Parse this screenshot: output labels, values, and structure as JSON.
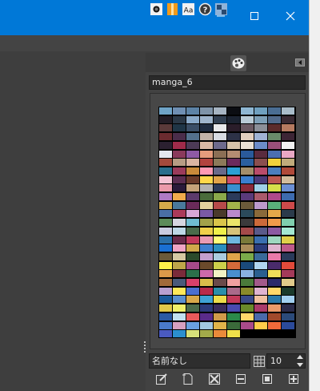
{
  "window": {
    "minimize_icon": "minimize-icon",
    "maximize_icon": "maximize-icon",
    "close_icon": "close-icon"
  },
  "panel": {
    "tabs": [
      {
        "icon": "brush-dynamics-icon"
      },
      {
        "icon": "pattern-icon"
      },
      {
        "icon": "fonts-icon",
        "label": "Aa"
      },
      {
        "icon": "help-icon",
        "label": "?"
      },
      {
        "icon": "image-icon"
      },
      {
        "icon": "palette-icon",
        "active": true
      }
    ],
    "palette_name": "manga_6",
    "entry_name": "名前なし",
    "columns": "10",
    "toolbar": [
      {
        "icon": "edit-icon"
      },
      {
        "icon": "new-entry-icon"
      },
      {
        "icon": "delete-icon"
      },
      {
        "icon": "fg-color-icon"
      },
      {
        "icon": "bg-color-icon"
      },
      {
        "icon": "add-icon"
      }
    ]
  },
  "palette": {
    "colors": [
      "#6fa3c7",
      "#6f8fb3",
      "#5d83a6",
      "#7f93a8",
      "#a6b4c2",
      "#0b0d12",
      "#8fb7d3",
      "#6fa0bf",
      "#4a6d93",
      "#a9bcc9",
      "#231d26",
      "#2b3846",
      "#8aa9c8",
      "#9fb4cb",
      "#324052",
      "#1b2331",
      "#b9cbd6",
      "#7d9fb7",
      "#526a8b",
      "#3a2a33",
      "#5a3a3a",
      "#1f3546",
      "#3b4e66",
      "#1f2b3f",
      "#e8e8ea",
      "#2a1d2a",
      "#6b5a63",
      "#8b8f98",
      "#5c2b2b",
      "#b57a60",
      "#6b2b2f",
      "#4a2d4a",
      "#54718d",
      "#c1b2a8",
      "#d8dbe2",
      "#2d3247",
      "#e2cfbe",
      "#a0b3d4",
      "#6a8a6a",
      "#3d2535",
      "#2b2030",
      "#a02b4a",
      "#4c3a56",
      "#d8b8a6",
      "#6d6a8c",
      "#d6c3aa",
      "#e9e0d4",
      "#6c8cc9",
      "#9a4f7a",
      "#f2f2f2",
      "#e4e6ee",
      "#8a3a5b",
      "#8e5aa4",
      "#e59c7c",
      "#8b6f55",
      "#b58c72",
      "#2a5a9b",
      "#5a2b3e",
      "#4b6fb0",
      "#e9a8c4",
      "#a44a3c",
      "#b79c84",
      "#d9b4a2",
      "#b2433f",
      "#8c7a5a",
      "#6b2b5c",
      "#2b5f9f",
      "#8a4f4f",
      "#f0d23c",
      "#c1ab7b",
      "#2b6f8c",
      "#9b3b5b",
      "#c98a3a",
      "#ff9ab3",
      "#6a6a8a",
      "#2b9fd4",
      "#a38e6b",
      "#ba4c6a",
      "#4a7fbf",
      "#b04a3a",
      "#f3c4d4",
      "#5c2d51",
      "#6b3b2b",
      "#ffd84a",
      "#e2a44a",
      "#cb4e6a",
      "#3b7fcf",
      "#4a3a7a",
      "#bc5a52",
      "#d2bc9c",
      "#ea9aaa",
      "#2a1a3a",
      "#c5a37a",
      "#b2b2b2",
      "#2b3b5a",
      "#3a8fcf",
      "#8a2a3a",
      "#9fd1e9",
      "#d6e04a",
      "#6b8fd4",
      "#b07ac4",
      "#f1ac4c",
      "#5c3a6b",
      "#4a6b3b",
      "#8aa94a",
      "#2b3b5b",
      "#5a3a7a",
      "#aa5a6b",
      "#b04a8a",
      "#3d6bb0",
      "#d4aa4a",
      "#4a7a9b",
      "#6a2b5a",
      "#e3cf9c",
      "#b64a4a",
      "#a2b24a",
      "#6b5a3a",
      "#bb9acc",
      "#5aaf7a",
      "#ce4a4a",
      "#4a6fa5",
      "#ab3a5a",
      "#d7a8d6",
      "#7b5aa4",
      "#4a3a2b",
      "#ba8acc",
      "#2b4a5b",
      "#8a6a3a",
      "#e3a84a",
      "#2b3b4b",
      "#5c8c5a",
      "#d6d6e0",
      "#6fbcd0",
      "#a2a24a",
      "#d9c54a",
      "#ebe46a",
      "#3b3a3b",
      "#cc6a3a",
      "#ef9b4a",
      "#7fcfae",
      "#c9cce0",
      "#bdd8e6",
      "#4a6b4a",
      "#efd04a",
      "#f0f04a",
      "#d7c27a",
      "#a44a4a",
      "#5a5a8a",
      "#8c5aa2",
      "#a4e8d2",
      "#2b6fa7",
      "#6a2a4a",
      "#c03a5a",
      "#ea9bb4",
      "#fffc7a",
      "#6fb7e0",
      "#7a7a3a",
      "#3a6fb0",
      "#9ed8c0",
      "#e0d04a",
      "#1a6fd2",
      "#f0a4c4",
      "#d0a84a",
      "#3f7fcf",
      "#2b8fbf",
      "#5a2b4a",
      "#aa8c5a",
      "#2b3b7b",
      "#e0b4cf",
      "#bf5a8a",
      "#6a5a3a",
      "#d6c8a2",
      "#2b4a2b",
      "#c29fcf",
      "#aacce0",
      "#e0a44a",
      "#7aaa4a",
      "#3a6a9a",
      "#ea7aaa",
      "#2a3a5a",
      "#fff24a",
      "#bea64a",
      "#a64a8a",
      "#6a4a2b",
      "#ccd04a",
      "#d46a3a",
      "#1a4a7b",
      "#b1d6f0",
      "#4a2b6b",
      "#e24a3a",
      "#dc9a4a",
      "#7a2b3a",
      "#2b6f4a",
      "#cc6aaa",
      "#f2f2c4",
      "#4a8fcf",
      "#8ab2e0",
      "#2a5f8f",
      "#eedc5a",
      "#a43a5a",
      "#a06a3a",
      "#4a5a7a",
      "#d6406a",
      "#d9bc4a",
      "#6a4a4a",
      "#f0a0a0",
      "#4a7a3a",
      "#a25a8a",
      "#2b2b6b",
      "#e0ca8a",
      "#b8a0d0",
      "#ffe85a",
      "#4a6fcf",
      "#b82b4a",
      "#2b8faa",
      "#aa6a8a",
      "#8a8a2b",
      "#e0b4d0",
      "#ffd86a",
      "#1a3a2b",
      "#1a5a9a",
      "#5a8fcf",
      "#d8a84a",
      "#3fa2d4",
      "#eedd4a",
      "#c43a5a",
      "#3a4a8a",
      "#f0c0a0",
      "#2a7aaa",
      "#a2d0f0",
      "#e0c84a",
      "#f0f06a",
      "#4a6a4a",
      "#2b3a7a",
      "#3a2b5a",
      "#4a4ab0",
      "#6a8a2b",
      "#aa3a6a",
      "#ea9a6a",
      "#2b2b4a",
      "#2b5aa4",
      "#c2e0f0",
      "#ea5a5a",
      "#5a2b8a",
      "#d09a4a",
      "#2b8a4a",
      "#ffd86a",
      "#4a6aaa",
      "#a24a2b",
      "#2b4a7a",
      "#4a7aca",
      "#d6a0c0",
      "#6aa0e0",
      "#a2c8e0",
      "#e0b44a",
      "#3a6a3a",
      "#aa4a8a",
      "#ffcc4a",
      "#f06a3a",
      "#2b4a9a",
      "#4a5abf",
      "#2b8fcf",
      "#d6e07a",
      "#a2aa4a",
      "#ea8a3a",
      "#f0e04a",
      "#000000",
      "#000000",
      "#000000",
      "#000000"
    ]
  }
}
